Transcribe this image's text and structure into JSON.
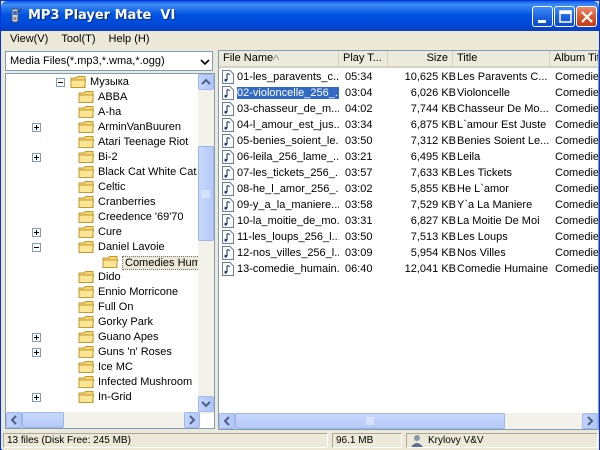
{
  "window": {
    "title": "MP3 Player Mate  VI",
    "colors": {
      "titlebar": "#0054e3",
      "selection": "#316ac5",
      "folder": "#f7d774"
    }
  },
  "menu": {
    "items": [
      {
        "label": "View(V)"
      },
      {
        "label": "Tool(T)"
      },
      {
        "label": "Help (H)"
      }
    ]
  },
  "filter": {
    "value": "Media Files(*.mp3,*.wma,*.ogg)"
  },
  "tree": {
    "items": [
      {
        "label": "Музыка",
        "expander": "minus"
      },
      {
        "label": "ABBA",
        "expander": ""
      },
      {
        "label": "A-ha",
        "expander": ""
      },
      {
        "label": "ArminVanBuuren",
        "expander": "plus"
      },
      {
        "label": "Atari Teenage Riot",
        "expander": ""
      },
      {
        "label": "Bi-2",
        "expander": "plus"
      },
      {
        "label": "Black Cat White Cat",
        "expander": ""
      },
      {
        "label": "Celtic",
        "expander": ""
      },
      {
        "label": "Cranberries",
        "expander": ""
      },
      {
        "label": "Creedence '69'70",
        "expander": ""
      },
      {
        "label": "Cure",
        "expander": "plus"
      },
      {
        "label": "Daniel Lavoie",
        "expander": "minus"
      },
      {
        "label": "Comedies Humaines",
        "expander": "",
        "selected": true
      },
      {
        "label": "Dido",
        "expander": ""
      },
      {
        "label": "Ennio Morricone",
        "expander": ""
      },
      {
        "label": "Full On",
        "expander": ""
      },
      {
        "label": "Gorky Park",
        "expander": ""
      },
      {
        "label": "Guano Apes",
        "expander": "plus"
      },
      {
        "label": "Guns 'n' Roses",
        "expander": "plus"
      },
      {
        "label": "Ice MC",
        "expander": ""
      },
      {
        "label": "Infected Mushroom",
        "expander": ""
      },
      {
        "label": "In-Grid",
        "expander": "plus"
      }
    ]
  },
  "files": {
    "columns": [
      "File Name",
      "Play T...",
      "Size",
      "Title",
      "Album Tit"
    ],
    "rows": [
      {
        "name": "01-les_paravents_c...",
        "time": "05:34",
        "size": "10,625 KB",
        "title": "Les Paravents C...",
        "album": "Comedies"
      },
      {
        "name": "02-violoncelle_256_...",
        "time": "03:04",
        "size": "6,026 KB",
        "title": "Violoncelle",
        "album": "Comedies",
        "selected": true
      },
      {
        "name": "03-chasseur_de_m...",
        "time": "04:02",
        "size": "7,744 KB",
        "title": "Chasseur De Mo...",
        "album": "Comedies"
      },
      {
        "name": "04-l_amour_est_jus...",
        "time": "03:34",
        "size": "6,875 KB",
        "title": "L`amour Est Juste",
        "album": "Comedies"
      },
      {
        "name": "05-benies_soient_le...",
        "time": "03:50",
        "size": "7,312 KB",
        "title": "Benies Soient Le...",
        "album": "Comedies"
      },
      {
        "name": "06-leila_256_lame_...",
        "time": "03:21",
        "size": "6,495 KB",
        "title": "Leila",
        "album": "Comedies"
      },
      {
        "name": "07-les_tickets_256_...",
        "time": "03:57",
        "size": "7,633 KB",
        "title": "Les Tickets",
        "album": "Comedies"
      },
      {
        "name": "08-he_l_amor_256_...",
        "time": "03:02",
        "size": "5,855 KB",
        "title": "He L`amor",
        "album": "Comedies"
      },
      {
        "name": "09-y_a_la_maniere...",
        "time": "03:58",
        "size": "7,529 KB",
        "title": "Y`a La Maniere",
        "album": "Comedies"
      },
      {
        "name": "10-la_moitie_de_mo...",
        "time": "03:31",
        "size": "6,827 KB",
        "title": "La Moitie De Moi",
        "album": "Comedies"
      },
      {
        "name": "11-les_loups_256_l...",
        "time": "03:50",
        "size": "7,513 KB",
        "title": "Les Loups",
        "album": "Comedies"
      },
      {
        "name": "12-nos_villes_256_l...",
        "time": "03:09",
        "size": "5,954 KB",
        "title": "Nos Villes",
        "album": "Comedies"
      },
      {
        "name": "13-comedie_humain...",
        "time": "06:40",
        "size": "12,041 KB",
        "title": "Comedie Humaine",
        "album": "Comedies"
      }
    ]
  },
  "status": {
    "files": "13 files (Disk Free: 245 MB)",
    "total": "96.1 MB",
    "user": "Krylovy V&V"
  }
}
